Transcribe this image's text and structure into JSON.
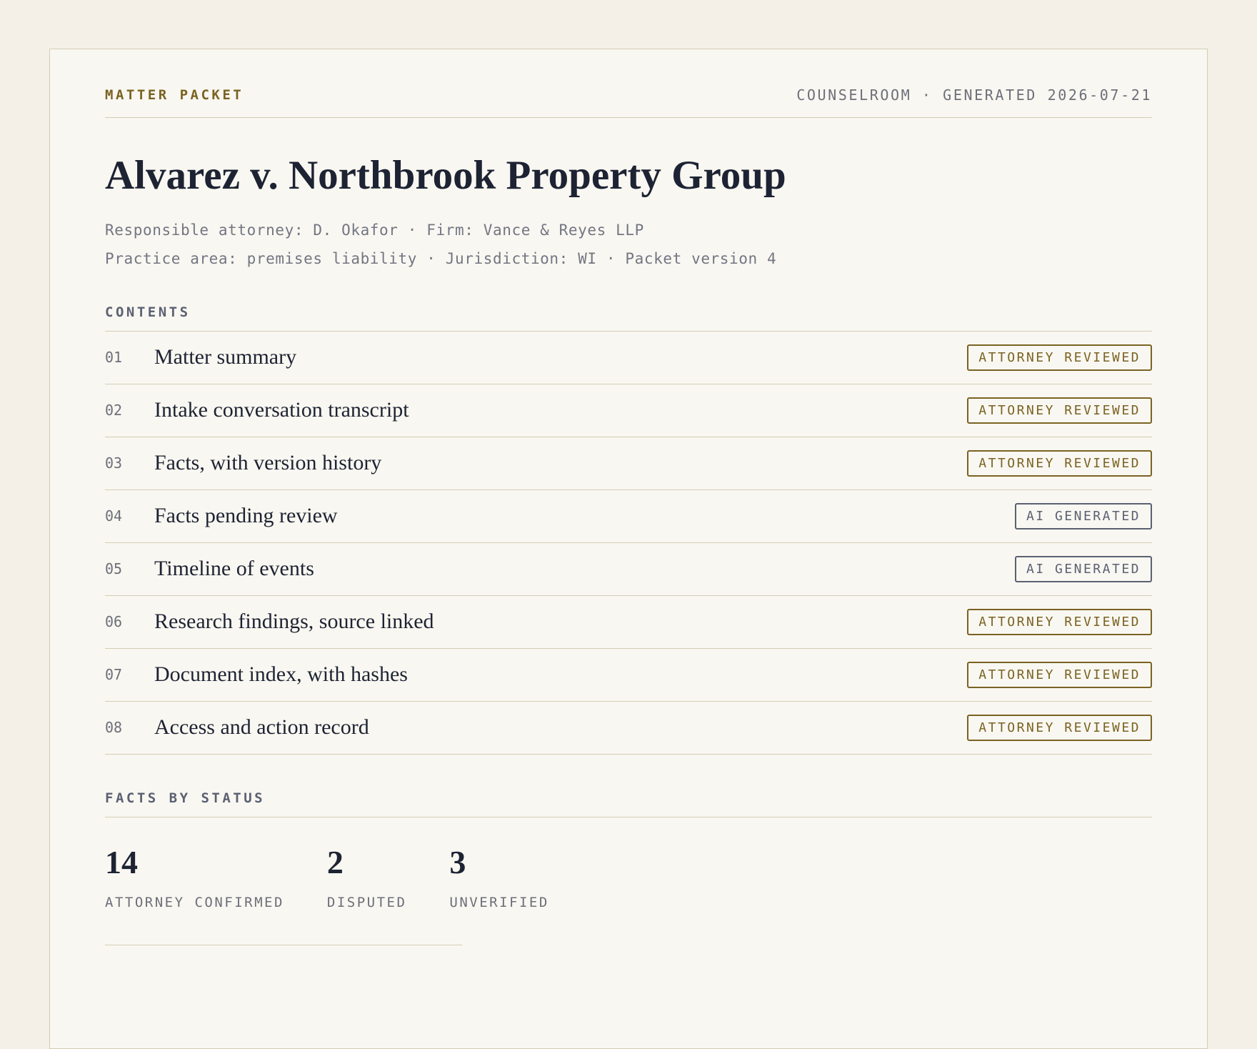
{
  "header": {
    "eyebrow": "MATTER PACKET",
    "meta_right": "COUNSELROOM · GENERATED 2026-07-21"
  },
  "title": "Alvarez v. Northbrook Property Group",
  "meta_lines": [
    "Responsible attorney: D. Okafor · Firm: Vance & Reyes LLP",
    "Practice area: premises liability · Jurisdiction: WI · Packet version 4"
  ],
  "contents": {
    "label": "CONTENTS",
    "items": [
      {
        "num": "01",
        "title": "Matter summary",
        "badge": "ATTORNEY REVIEWED",
        "badge_type": "reviewed"
      },
      {
        "num": "02",
        "title": "Intake conversation transcript",
        "badge": "ATTORNEY REVIEWED",
        "badge_type": "reviewed"
      },
      {
        "num": "03",
        "title": "Facts, with version history",
        "badge": "ATTORNEY REVIEWED",
        "badge_type": "reviewed"
      },
      {
        "num": "04",
        "title": "Facts pending review",
        "badge": "AI GENERATED",
        "badge_type": "ai"
      },
      {
        "num": "05",
        "title": "Timeline of events",
        "badge": "AI GENERATED",
        "badge_type": "ai"
      },
      {
        "num": "06",
        "title": "Research findings, source linked",
        "badge": "ATTORNEY REVIEWED",
        "badge_type": "reviewed"
      },
      {
        "num": "07",
        "title": "Document index, with hashes",
        "badge": "ATTORNEY REVIEWED",
        "badge_type": "reviewed"
      },
      {
        "num": "08",
        "title": "Access and action record",
        "badge": "ATTORNEY REVIEWED",
        "badge_type": "reviewed"
      }
    ]
  },
  "facts_by_status": {
    "label": "FACTS BY STATUS",
    "stats": [
      {
        "value": "14",
        "label": "ATTORNEY CONFIRMED"
      },
      {
        "value": "2",
        "label": "DISPUTED"
      },
      {
        "value": "3",
        "label": "UNVERIFIED"
      }
    ]
  },
  "colors": {
    "accent": "#7a6323",
    "ai_badge": "#5b6173",
    "text": "#1d2333",
    "background": "#f9f7f1"
  }
}
